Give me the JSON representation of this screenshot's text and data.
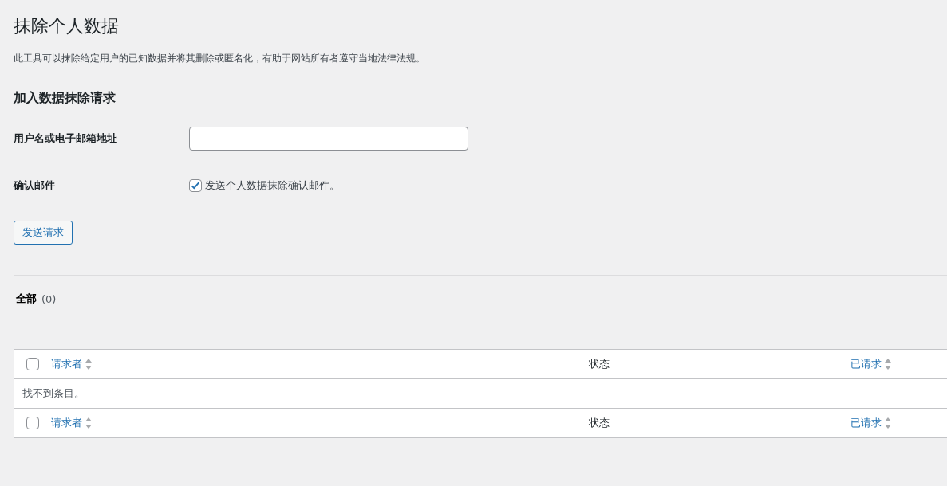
{
  "page_title": "抹除个人数据",
  "description": "此工具可以抹除给定用户的已知数据并将其删除或匿名化，有助于网站所有者遵守当地法律法规。",
  "form": {
    "heading": "加入数据抹除请求",
    "fields": [
      {
        "kind": "text",
        "label": "用户名或电子邮箱地址"
      },
      {
        "kind": "checkbox",
        "label": "确认邮件",
        "option": "发送个人数据抹除确认邮件。",
        "checked": true
      }
    ],
    "submit": "发送请求"
  },
  "filters": [
    {
      "label": "全部",
      "count": "(0)",
      "selected": true
    }
  ],
  "table": {
    "header": {
      "select_all_checked": false,
      "columns": [
        {
          "label": "请求者",
          "sortable": true
        },
        {
          "label": "状态",
          "sortable": false
        },
        {
          "label": "已请求",
          "sortable": true
        }
      ]
    },
    "empty_message": "找不到条目。",
    "footer": {
      "select_all_checked": false,
      "columns": [
        {
          "label": "请求者",
          "sortable": true
        },
        {
          "label": "状态",
          "sortable": false
        },
        {
          "label": "已请求",
          "sortable": true
        }
      ]
    }
  }
}
